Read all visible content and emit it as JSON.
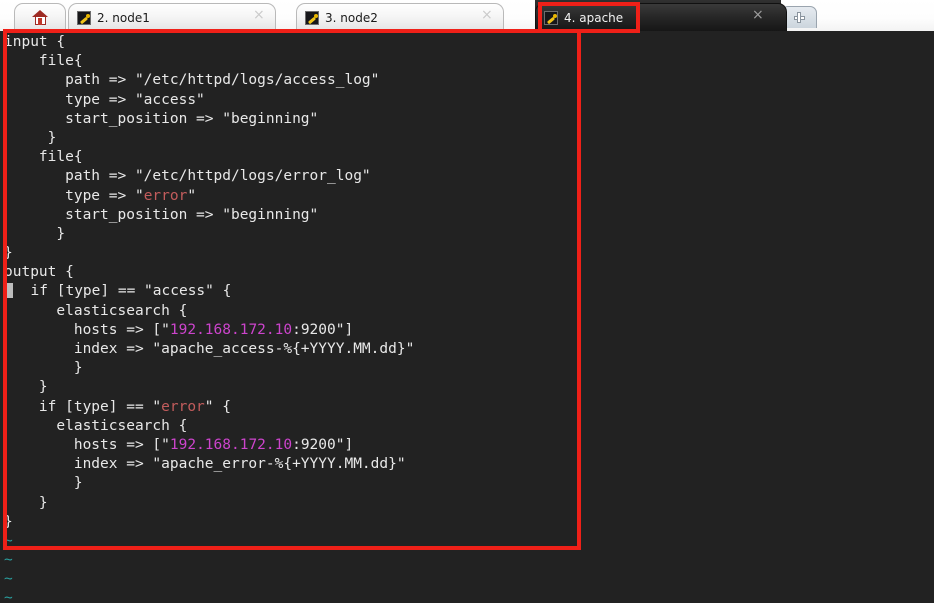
{
  "window": {
    "app": "PuTTY Connection Manager terminal with vim",
    "colors": {
      "terminal_bg": "#222222",
      "terminal_fg": "#e8e8e8",
      "string_red": "#c25c5c",
      "number_magenta": "#cc44cc",
      "tilde_cyan": "#2a9d9d",
      "annotation_red": "#ef2018",
      "active_tab_bg": "#262626"
    }
  },
  "tabbar": {
    "home_tab": {
      "icon": "home-icon",
      "label": ""
    },
    "tabs": [
      {
        "label": "2. node1",
        "icon": "putty-terminal-icon",
        "active": false,
        "close": "×"
      },
      {
        "label": "3. node2",
        "icon": "putty-terminal-icon",
        "active": false,
        "close": "×"
      },
      {
        "label": "4. apache",
        "icon": "putty-terminal-icon",
        "active": true,
        "close": "×"
      }
    ],
    "new_tab": {
      "icon": "plus-icon",
      "label": ""
    }
  },
  "terminal": {
    "lines": [
      {
        "segments": [
          {
            "text": "input {",
            "color": "default"
          }
        ]
      },
      {
        "segments": [
          {
            "text": "    file{",
            "color": "default"
          }
        ]
      },
      {
        "segments": [
          {
            "text": "       path => \"/etc/httpd/logs/access_log\"",
            "color": "default"
          }
        ]
      },
      {
        "segments": [
          {
            "text": "       type => \"access\"",
            "color": "default"
          }
        ]
      },
      {
        "segments": [
          {
            "text": "       start_position => \"beginning\"",
            "color": "default"
          }
        ]
      },
      {
        "segments": [
          {
            "text": "     }",
            "color": "default"
          }
        ]
      },
      {
        "segments": [
          {
            "text": "    file{",
            "color": "default"
          }
        ]
      },
      {
        "segments": [
          {
            "text": "       path => \"/etc/httpd/logs/error_log\"",
            "color": "default"
          }
        ]
      },
      {
        "segments": [
          {
            "text": "       type => \"",
            "color": "default"
          },
          {
            "text": "error",
            "color": "red"
          },
          {
            "text": "\"",
            "color": "default"
          }
        ]
      },
      {
        "segments": [
          {
            "text": "       start_position => \"beginning\"",
            "color": "default"
          }
        ]
      },
      {
        "segments": [
          {
            "text": "      }",
            "color": "default"
          }
        ]
      },
      {
        "segments": [
          {
            "text": "}",
            "color": "default"
          }
        ]
      },
      {
        "segments": [
          {
            "text": "output {",
            "color": "default"
          }
        ]
      },
      {
        "segments": [
          {
            "text": " ",
            "color": "cursor"
          },
          {
            "text": "  if [type] == \"access\" {",
            "color": "default"
          }
        ]
      },
      {
        "segments": [
          {
            "text": "      elasticsearch {",
            "color": "default"
          }
        ]
      },
      {
        "segments": [
          {
            "text": "        hosts => [\"",
            "color": "default"
          },
          {
            "text": "192.168.172.10",
            "color": "magenta"
          },
          {
            "text": ":9200\"]",
            "color": "default"
          }
        ]
      },
      {
        "segments": [
          {
            "text": "        index => \"apache_access-%{+YYYY.MM.dd}\"",
            "color": "default"
          }
        ]
      },
      {
        "segments": [
          {
            "text": "        }",
            "color": "default"
          }
        ]
      },
      {
        "segments": [
          {
            "text": "    }",
            "color": "default"
          }
        ]
      },
      {
        "segments": [
          {
            "text": "    if [type] == \"",
            "color": "default"
          },
          {
            "text": "error",
            "color": "red"
          },
          {
            "text": "\" {",
            "color": "default"
          }
        ]
      },
      {
        "segments": [
          {
            "text": "      elasticsearch {",
            "color": "default"
          }
        ]
      },
      {
        "segments": [
          {
            "text": "        hosts => [\"",
            "color": "default"
          },
          {
            "text": "192.168.172.10",
            "color": "magenta"
          },
          {
            "text": ":9200\"]",
            "color": "default"
          }
        ]
      },
      {
        "segments": [
          {
            "text": "        index => \"apache_error-%{+YYYY.MM.dd}\"",
            "color": "default"
          }
        ]
      },
      {
        "segments": [
          {
            "text": "        }",
            "color": "default"
          }
        ]
      },
      {
        "segments": [
          {
            "text": "    }",
            "color": "default"
          }
        ]
      },
      {
        "segments": [
          {
            "text": "}",
            "color": "default"
          }
        ]
      },
      {
        "segments": [
          {
            "text": "~",
            "color": "tilde"
          }
        ]
      },
      {
        "segments": [
          {
            "text": "~",
            "color": "tilde"
          }
        ]
      },
      {
        "segments": [
          {
            "text": "~",
            "color": "tilde"
          }
        ]
      },
      {
        "segments": [
          {
            "text": "~",
            "color": "tilde"
          }
        ]
      }
    ]
  },
  "annotations": [
    {
      "name": "code-block-highlight",
      "shape": "rectangle",
      "color": "#ef2018"
    },
    {
      "name": "active-tab-highlight",
      "shape": "rectangle",
      "color": "#ef2018"
    }
  ]
}
